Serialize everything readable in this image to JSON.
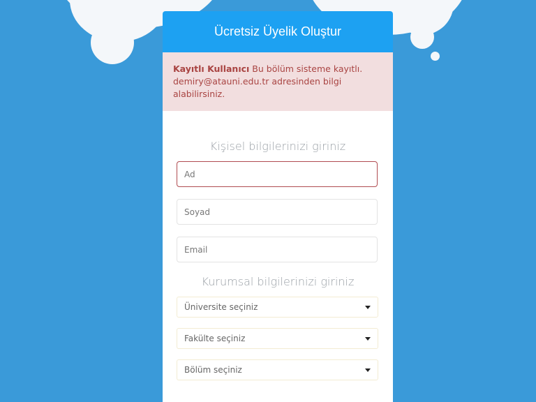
{
  "colors": {
    "background": "#3a9ad9",
    "header": "#1da1f2",
    "alert_bg": "#f2dedf",
    "alert_text": "#a94442"
  },
  "form": {
    "title": "Ücretsiz Üyelik Oluştur",
    "alert": {
      "bold": "Kayıtlı Kullanıcı",
      "message": " Bu bölüm sisteme kayıtlı. demiry@atauni.edu.tr adresinden bilgi alabilirsiniz."
    },
    "personal_heading": "Kişisel bilgilerinizi giriniz",
    "first_name_placeholder": "Ad",
    "last_name_placeholder": "Soyad",
    "email_placeholder": "Email",
    "institution_heading": "Kurumsal bilgilerinizi giriniz",
    "university_select": "Üniversite seçiniz",
    "faculty_select": "Fakülte seçiniz",
    "department_select": "Bölüm seçiniz"
  }
}
